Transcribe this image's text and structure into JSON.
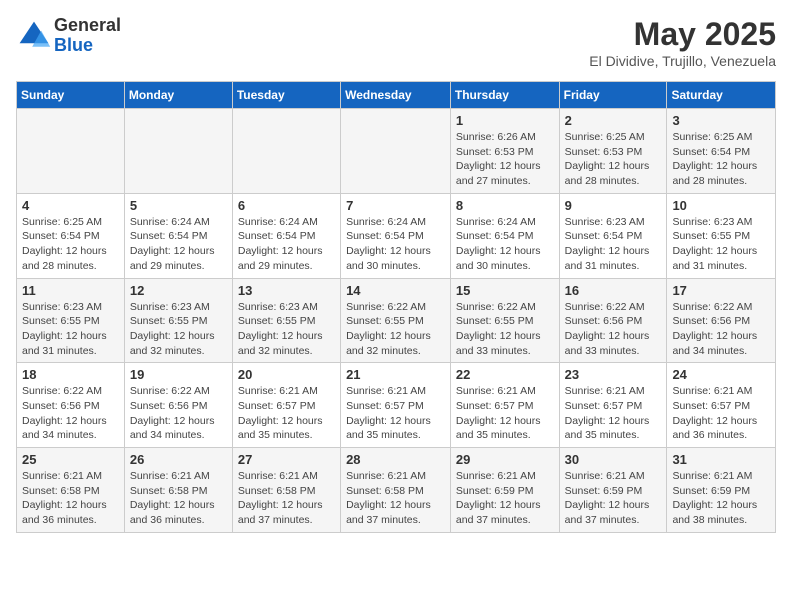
{
  "logo": {
    "general": "General",
    "blue": "Blue"
  },
  "title": "May 2025",
  "subtitle": "El Dividive, Trujillo, Venezuela",
  "headers": [
    "Sunday",
    "Monday",
    "Tuesday",
    "Wednesday",
    "Thursday",
    "Friday",
    "Saturday"
  ],
  "weeks": [
    [
      {
        "day": "",
        "info": ""
      },
      {
        "day": "",
        "info": ""
      },
      {
        "day": "",
        "info": ""
      },
      {
        "day": "",
        "info": ""
      },
      {
        "day": "1",
        "info": "Sunrise: 6:26 AM\nSunset: 6:53 PM\nDaylight: 12 hours and 27 minutes."
      },
      {
        "day": "2",
        "info": "Sunrise: 6:25 AM\nSunset: 6:53 PM\nDaylight: 12 hours and 28 minutes."
      },
      {
        "day": "3",
        "info": "Sunrise: 6:25 AM\nSunset: 6:54 PM\nDaylight: 12 hours and 28 minutes."
      }
    ],
    [
      {
        "day": "4",
        "info": "Sunrise: 6:25 AM\nSunset: 6:54 PM\nDaylight: 12 hours and 28 minutes."
      },
      {
        "day": "5",
        "info": "Sunrise: 6:24 AM\nSunset: 6:54 PM\nDaylight: 12 hours and 29 minutes."
      },
      {
        "day": "6",
        "info": "Sunrise: 6:24 AM\nSunset: 6:54 PM\nDaylight: 12 hours and 29 minutes."
      },
      {
        "day": "7",
        "info": "Sunrise: 6:24 AM\nSunset: 6:54 PM\nDaylight: 12 hours and 30 minutes."
      },
      {
        "day": "8",
        "info": "Sunrise: 6:24 AM\nSunset: 6:54 PM\nDaylight: 12 hours and 30 minutes."
      },
      {
        "day": "9",
        "info": "Sunrise: 6:23 AM\nSunset: 6:54 PM\nDaylight: 12 hours and 31 minutes."
      },
      {
        "day": "10",
        "info": "Sunrise: 6:23 AM\nSunset: 6:55 PM\nDaylight: 12 hours and 31 minutes."
      }
    ],
    [
      {
        "day": "11",
        "info": "Sunrise: 6:23 AM\nSunset: 6:55 PM\nDaylight: 12 hours and 31 minutes."
      },
      {
        "day": "12",
        "info": "Sunrise: 6:23 AM\nSunset: 6:55 PM\nDaylight: 12 hours and 32 minutes."
      },
      {
        "day": "13",
        "info": "Sunrise: 6:23 AM\nSunset: 6:55 PM\nDaylight: 12 hours and 32 minutes."
      },
      {
        "day": "14",
        "info": "Sunrise: 6:22 AM\nSunset: 6:55 PM\nDaylight: 12 hours and 32 minutes."
      },
      {
        "day": "15",
        "info": "Sunrise: 6:22 AM\nSunset: 6:55 PM\nDaylight: 12 hours and 33 minutes."
      },
      {
        "day": "16",
        "info": "Sunrise: 6:22 AM\nSunset: 6:56 PM\nDaylight: 12 hours and 33 minutes."
      },
      {
        "day": "17",
        "info": "Sunrise: 6:22 AM\nSunset: 6:56 PM\nDaylight: 12 hours and 34 minutes."
      }
    ],
    [
      {
        "day": "18",
        "info": "Sunrise: 6:22 AM\nSunset: 6:56 PM\nDaylight: 12 hours and 34 minutes."
      },
      {
        "day": "19",
        "info": "Sunrise: 6:22 AM\nSunset: 6:56 PM\nDaylight: 12 hours and 34 minutes."
      },
      {
        "day": "20",
        "info": "Sunrise: 6:21 AM\nSunset: 6:57 PM\nDaylight: 12 hours and 35 minutes."
      },
      {
        "day": "21",
        "info": "Sunrise: 6:21 AM\nSunset: 6:57 PM\nDaylight: 12 hours and 35 minutes."
      },
      {
        "day": "22",
        "info": "Sunrise: 6:21 AM\nSunset: 6:57 PM\nDaylight: 12 hours and 35 minutes."
      },
      {
        "day": "23",
        "info": "Sunrise: 6:21 AM\nSunset: 6:57 PM\nDaylight: 12 hours and 35 minutes."
      },
      {
        "day": "24",
        "info": "Sunrise: 6:21 AM\nSunset: 6:57 PM\nDaylight: 12 hours and 36 minutes."
      }
    ],
    [
      {
        "day": "25",
        "info": "Sunrise: 6:21 AM\nSunset: 6:58 PM\nDaylight: 12 hours and 36 minutes."
      },
      {
        "day": "26",
        "info": "Sunrise: 6:21 AM\nSunset: 6:58 PM\nDaylight: 12 hours and 36 minutes."
      },
      {
        "day": "27",
        "info": "Sunrise: 6:21 AM\nSunset: 6:58 PM\nDaylight: 12 hours and 37 minutes."
      },
      {
        "day": "28",
        "info": "Sunrise: 6:21 AM\nSunset: 6:58 PM\nDaylight: 12 hours and 37 minutes."
      },
      {
        "day": "29",
        "info": "Sunrise: 6:21 AM\nSunset: 6:59 PM\nDaylight: 12 hours and 37 minutes."
      },
      {
        "day": "30",
        "info": "Sunrise: 6:21 AM\nSunset: 6:59 PM\nDaylight: 12 hours and 37 minutes."
      },
      {
        "day": "31",
        "info": "Sunrise: 6:21 AM\nSunset: 6:59 PM\nDaylight: 12 hours and 38 minutes."
      }
    ]
  ]
}
